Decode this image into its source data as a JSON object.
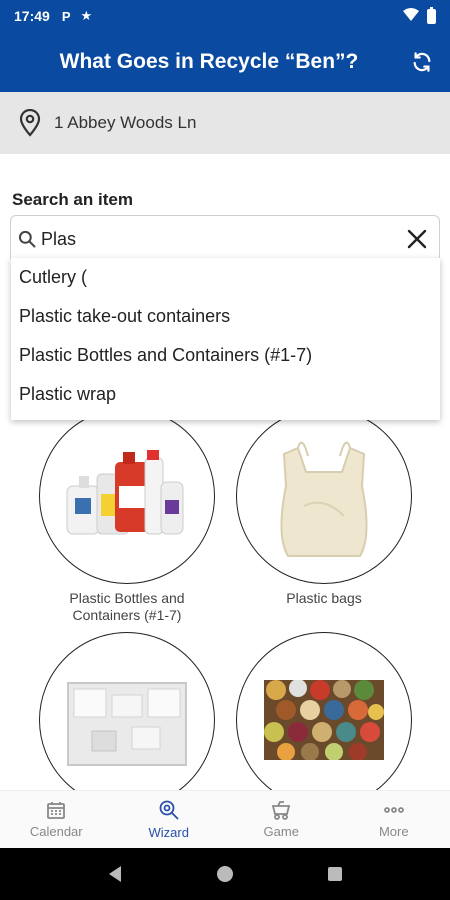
{
  "status_bar": {
    "time": "17:49",
    "icons": [
      "parking-icon",
      "star-icon",
      "wifi-icon",
      "battery-icon"
    ]
  },
  "app_bar": {
    "title": "What Goes in Recycle “Ben”?",
    "refresh_icon": "refresh-icon"
  },
  "address": {
    "icon": "location-pin-icon",
    "text": "1 Abbey Woods Ln"
  },
  "search": {
    "label": "Search an item",
    "value": "Plas",
    "icon": "search-icon",
    "clear_icon": "close-icon"
  },
  "suggestions": [
    "Cutlery (",
    "Plastic take-out containers",
    "Plastic Bottles and Containers (#1-7)",
    "Plastic wrap"
  ],
  "items": [
    {
      "label": "Plastic Bottles and Containers (#1-7)",
      "image": "plastic-bottles-image"
    },
    {
      "label": "Plastic bags",
      "image": "plastic-bag-image"
    },
    {
      "label": "",
      "image": "styrofoam-insert-image"
    },
    {
      "label": "",
      "image": "rolled-rugs-image"
    }
  ],
  "bottom_nav": {
    "active": "Wizard",
    "items": [
      {
        "label": "Calendar",
        "icon": "calendar-icon"
      },
      {
        "label": "Wizard",
        "icon": "wizard-icon"
      },
      {
        "label": "Game",
        "icon": "game-icon"
      },
      {
        "label": "More",
        "icon": "more-icon"
      }
    ]
  },
  "colors": {
    "primary": "#0a4aa0",
    "address_bg": "#e6e6e6",
    "nav_active": "#2a4fa8",
    "nav_inactive": "#888888"
  }
}
